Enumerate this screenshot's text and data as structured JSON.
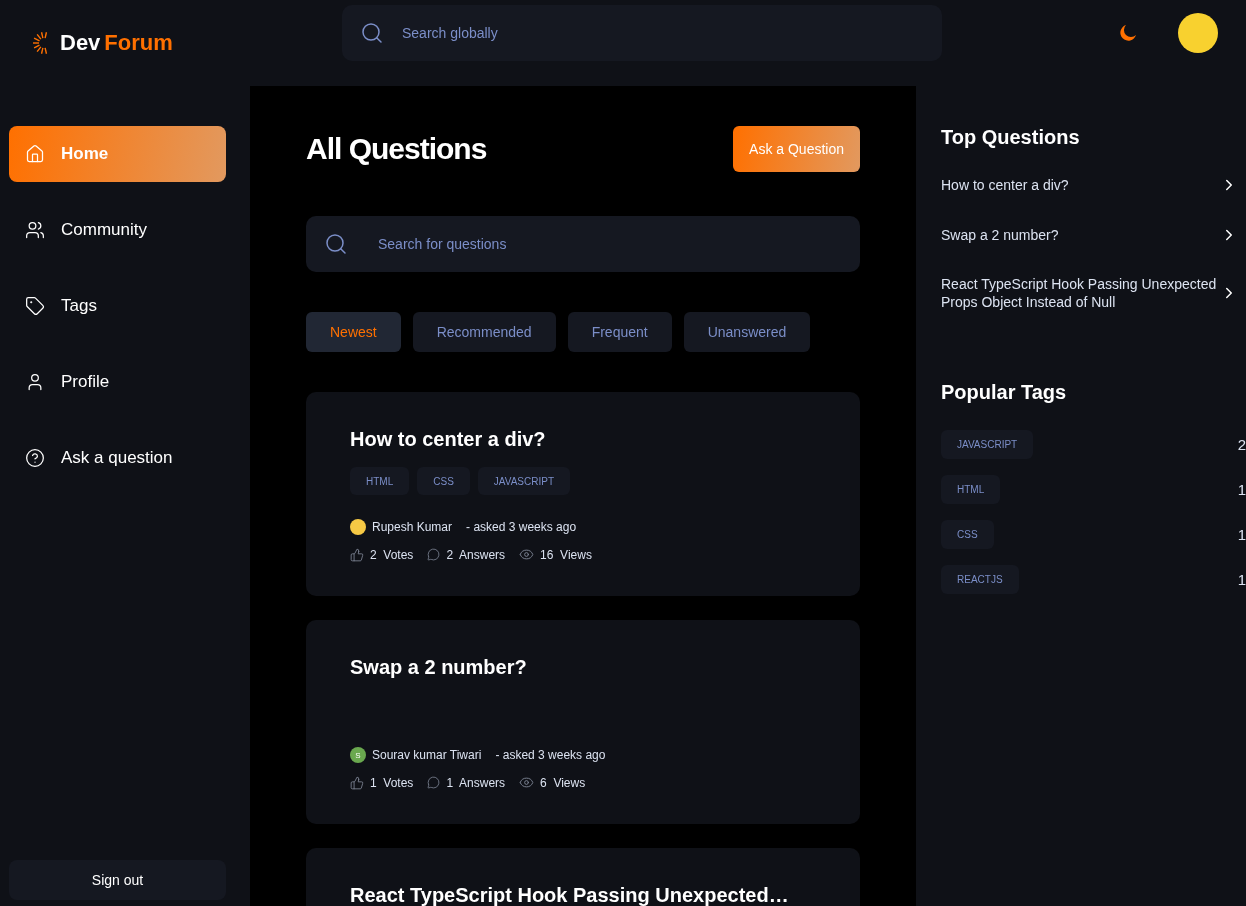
{
  "header": {
    "logo": {
      "first": "Dev",
      "second": "Forum"
    },
    "search": {
      "placeholder": "Search globally"
    }
  },
  "sidebar": {
    "items": [
      {
        "label": "Home",
        "selected": true
      },
      {
        "label": "Community",
        "selected": false
      },
      {
        "label": "Tags",
        "selected": false
      },
      {
        "label": "Profile",
        "selected": false
      },
      {
        "label": "Ask a question",
        "selected": false
      }
    ],
    "sign_out": "Sign out"
  },
  "main": {
    "title": "All Questions",
    "ask_button": "Ask a Question",
    "search": {
      "placeholder": "Search for questions"
    },
    "filters": [
      {
        "label": "Newest",
        "selected": true
      },
      {
        "label": "Recommended",
        "selected": false
      },
      {
        "label": "Frequent",
        "selected": false
      },
      {
        "label": "Unanswered",
        "selected": false
      }
    ],
    "questions": [
      {
        "title": "How to center a div?",
        "tags": [
          "HTML",
          "CSS",
          "JAVASCRIPT"
        ],
        "author": "Rupesh Kumar",
        "avatar": {
          "kind": "photo"
        },
        "asked": "- asked 3 weeks ago",
        "votes": "2",
        "votes_label": "Votes",
        "answers": "2",
        "answers_label": "Answers",
        "views": "16",
        "views_label": "Views"
      },
      {
        "title": "Swap a 2 number?",
        "author": "Sourav kumar Tiwari",
        "avatar": {
          "kind": "letter",
          "letter": "S",
          "color": "#6aa84f"
        },
        "asked": "- asked 3 weeks ago",
        "votes": "1",
        "votes_label": "Votes",
        "answers": "1",
        "answers_label": "Answers",
        "views": "6",
        "views_label": "Views"
      },
      {
        "title": "React TypeScript Hook Passing Unexpected…"
      }
    ]
  },
  "right": {
    "top_title": "Top Questions",
    "top_questions": [
      "How to center a div?",
      "Swap a 2 number?",
      "React TypeScript Hook Passing Unexpected Props Object Instead of Null"
    ],
    "tags_title": "Popular Tags",
    "popular_tags": [
      {
        "name": "JAVASCRIPT",
        "count": "2"
      },
      {
        "name": "HTML",
        "count": "1"
      },
      {
        "name": "CSS",
        "count": "1"
      },
      {
        "name": "REACTJS",
        "count": "1"
      }
    ]
  }
}
